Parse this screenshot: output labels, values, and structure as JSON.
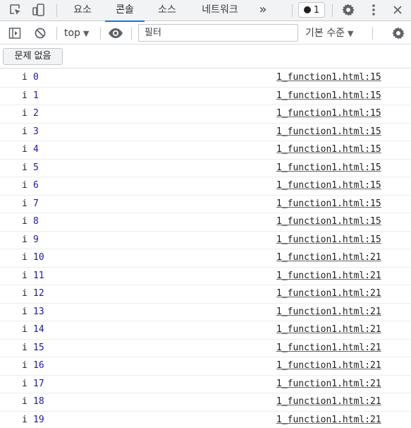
{
  "tabs": [
    {
      "label": "요소",
      "active": false
    },
    {
      "label": "콘솔",
      "active": true
    },
    {
      "label": "소스",
      "active": false
    },
    {
      "label": "네트워크",
      "active": false
    }
  ],
  "more_tabs_glyph": "»",
  "issue_counter": "1",
  "context_selector": {
    "value": "top",
    "caret": "▼"
  },
  "filter": {
    "placeholder": "필터",
    "value": ""
  },
  "log_level": {
    "value": "기본 수준",
    "caret": "▼"
  },
  "issues_button": "문제 없음",
  "icons": [
    "inspect-element-icon",
    "device-toolbar-icon",
    "gear-icon",
    "kebab-menu-icon",
    "sidebar-toggle-icon",
    "clear-console-icon",
    "eye-icon"
  ],
  "colors": {
    "accent": "#1a73e8",
    "number": "#1a1aa6",
    "tab_bar": "#f1f3f4"
  },
  "log_entries": [
    {
      "key": "i",
      "value": "0",
      "source": "1_function1.html:15"
    },
    {
      "key": "i",
      "value": "1",
      "source": "1_function1.html:15"
    },
    {
      "key": "i",
      "value": "2",
      "source": "1_function1.html:15"
    },
    {
      "key": "i",
      "value": "3",
      "source": "1_function1.html:15"
    },
    {
      "key": "i",
      "value": "4",
      "source": "1_function1.html:15"
    },
    {
      "key": "i",
      "value": "5",
      "source": "1_function1.html:15"
    },
    {
      "key": "i",
      "value": "6",
      "source": "1_function1.html:15"
    },
    {
      "key": "i",
      "value": "7",
      "source": "1_function1.html:15"
    },
    {
      "key": "i",
      "value": "8",
      "source": "1_function1.html:15"
    },
    {
      "key": "i",
      "value": "9",
      "source": "1_function1.html:15"
    },
    {
      "key": "i",
      "value": "10",
      "source": "1_function1.html:21"
    },
    {
      "key": "i",
      "value": "11",
      "source": "1_function1.html:21"
    },
    {
      "key": "i",
      "value": "12",
      "source": "1_function1.html:21"
    },
    {
      "key": "i",
      "value": "13",
      "source": "1_function1.html:21"
    },
    {
      "key": "i",
      "value": "14",
      "source": "1_function1.html:21"
    },
    {
      "key": "i",
      "value": "15",
      "source": "1_function1.html:21"
    },
    {
      "key": "i",
      "value": "16",
      "source": "1_function1.html:21"
    },
    {
      "key": "i",
      "value": "17",
      "source": "1_function1.html:21"
    },
    {
      "key": "i",
      "value": "18",
      "source": "1_function1.html:21"
    },
    {
      "key": "i",
      "value": "19",
      "source": "1_function1.html:21"
    }
  ]
}
